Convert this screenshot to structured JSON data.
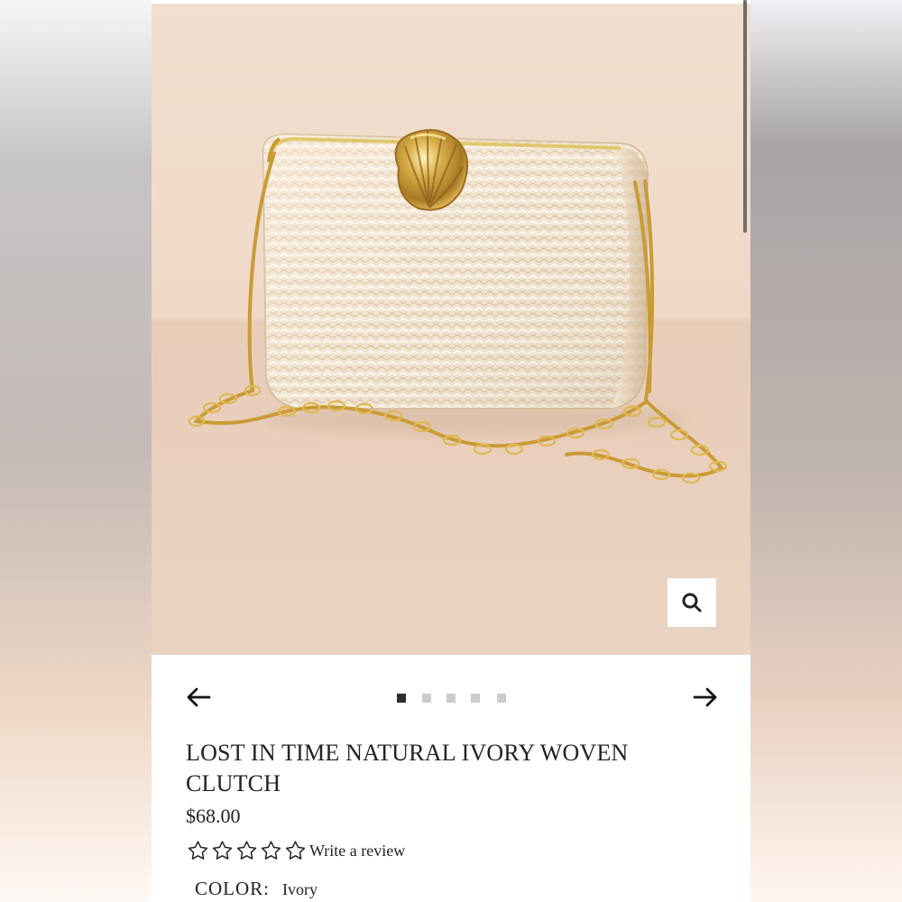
{
  "product": {
    "title": "LOST IN TIME NATURAL IVORY WOVEN CLUTCH",
    "price": "$68.00",
    "review_link": "Write a review",
    "rating": 0,
    "color_label": "COLOR:",
    "color_value": "Ivory",
    "image_alt": "Natural ivory woven clutch with gold shell clasp and chain strap"
  },
  "gallery": {
    "image_count": 5,
    "active_index": 0,
    "zoom_icon": "search-icon",
    "previous_icon": "arrow-left-icon",
    "next_icon": "arrow-right-icon"
  },
  "colors": {
    "page_background": "#ffffff",
    "text": "#222222",
    "dot_active": "#2d2d2d",
    "dot_inactive": "#cccccc",
    "image_background": "#efd8c6",
    "bag": "#f2e7d5",
    "gold": "#c99b35"
  }
}
